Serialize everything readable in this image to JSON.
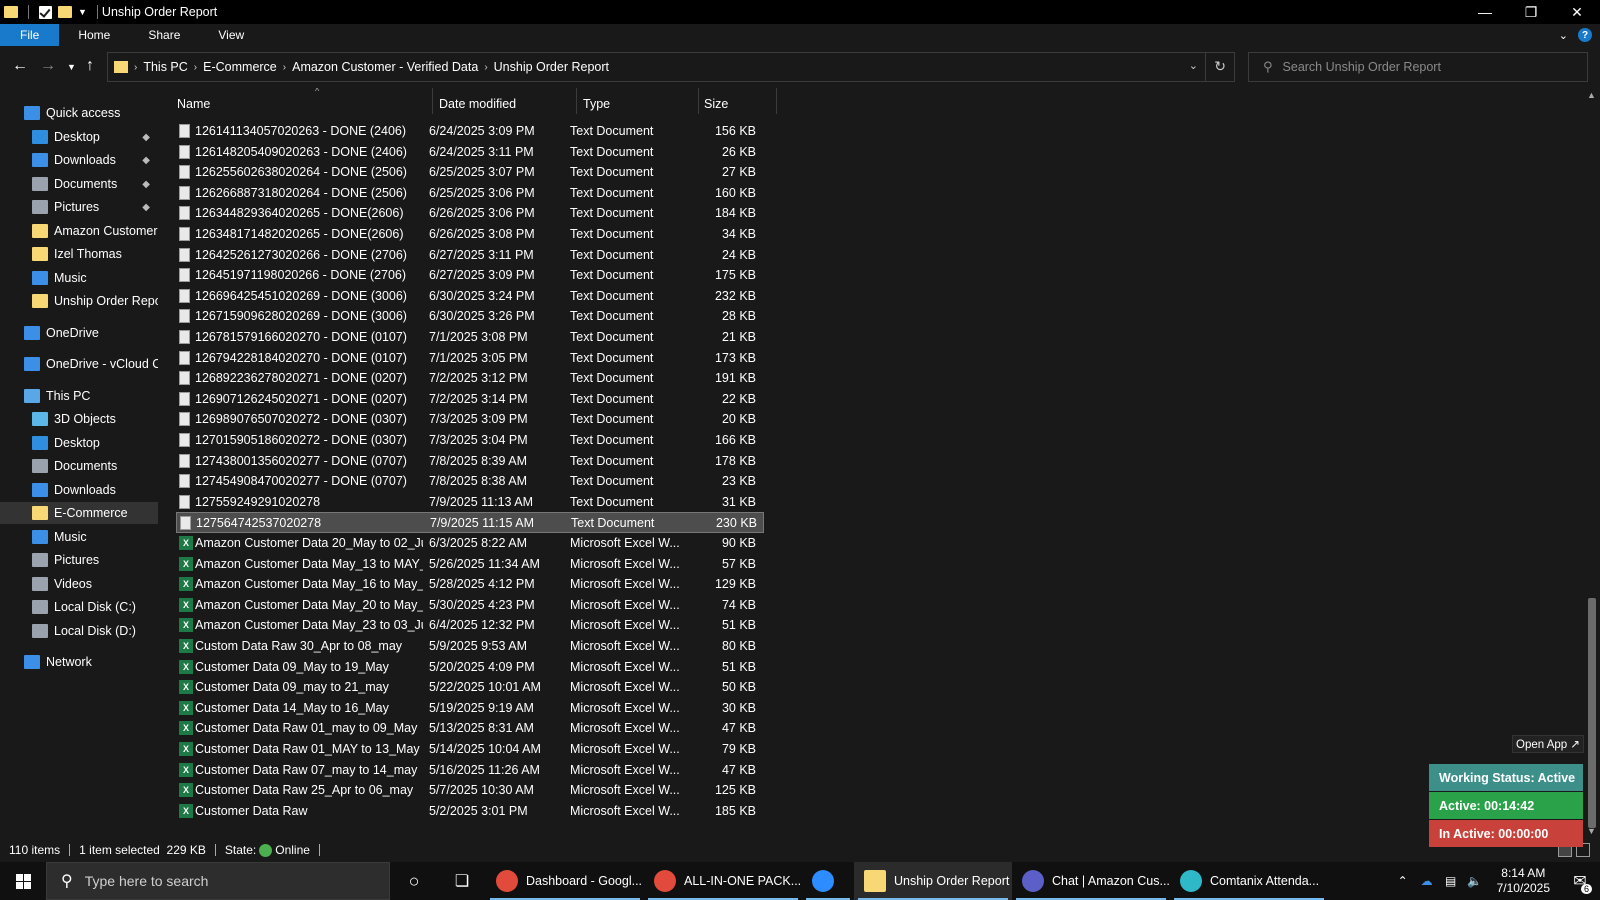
{
  "window": {
    "title": "Unship Order Report",
    "controls": [
      "minimize-icon",
      "restore-icon",
      "close-icon"
    ]
  },
  "ribbon": {
    "tabs": [
      "File",
      "Home",
      "Share",
      "View"
    ]
  },
  "address": {
    "crumbs": [
      "This PC",
      "E-Commerce",
      "Amazon Customer - Verified Data",
      "Unship Order Report"
    ]
  },
  "search": {
    "placeholder": "Search Unship Order Report"
  },
  "nav": {
    "items": [
      {
        "label": "Quick access",
        "icon": "star-icon",
        "color": "#3b8fe6",
        "pinned": false
      },
      {
        "label": "Desktop",
        "icon": "desktop-icon",
        "color": "#2f8ee0",
        "pinned": true
      },
      {
        "label": "Downloads",
        "icon": "download-icon",
        "color": "#3b8fe6",
        "pinned": true
      },
      {
        "label": "Documents",
        "icon": "documents-icon",
        "color": "#9aa3ad",
        "pinned": true
      },
      {
        "label": "Pictures",
        "icon": "pictures-icon",
        "color": "#9aa3ad",
        "pinned": true
      },
      {
        "label": "Amazon Customer",
        "icon": "folder-icon",
        "color": "#f8d775",
        "pinned": false
      },
      {
        "label": "Izel Thomas",
        "icon": "folder-icon",
        "color": "#f8d775",
        "pinned": false
      },
      {
        "label": "Music",
        "icon": "music-icon",
        "color": "#3b8fe6",
        "pinned": false
      },
      {
        "label": "Unship Order Repor",
        "icon": "folder-icon",
        "color": "#f8d775",
        "pinned": false
      },
      {
        "label": "OneDrive",
        "icon": "cloud-icon",
        "color": "#3b8fe6",
        "pinned": false
      },
      {
        "label": "OneDrive - vCloud Cl",
        "icon": "cloud-icon",
        "color": "#3b8fe6",
        "pinned": false
      },
      {
        "label": "This PC",
        "icon": "pc-icon",
        "color": "#5aa7e8",
        "pinned": false
      },
      {
        "label": "3D Objects",
        "icon": "3d-objects-icon",
        "color": "#5ab7e8",
        "pinned": false
      },
      {
        "label": "Desktop",
        "icon": "desktop-icon",
        "color": "#2f8ee0",
        "pinned": false
      },
      {
        "label": "Documents",
        "icon": "documents-icon",
        "color": "#9aa3ad",
        "pinned": false
      },
      {
        "label": "Downloads",
        "icon": "download-icon",
        "color": "#3b8fe6",
        "pinned": false
      },
      {
        "label": "E-Commerce",
        "icon": "folder-icon",
        "color": "#f8d775",
        "pinned": false
      },
      {
        "label": "Music",
        "icon": "music-icon",
        "color": "#3b8fe6",
        "pinned": false
      },
      {
        "label": "Pictures",
        "icon": "pictures-icon",
        "color": "#9aa3ad",
        "pinned": false
      },
      {
        "label": "Videos",
        "icon": "videos-icon",
        "color": "#9aa3ad",
        "pinned": false
      },
      {
        "label": "Local Disk (C:)",
        "icon": "drive-icon",
        "color": "#9aa3ad",
        "pinned": false
      },
      {
        "label": "Local Disk (D:)",
        "icon": "drive-icon",
        "color": "#9aa3ad",
        "pinned": false
      },
      {
        "label": "Network",
        "icon": "network-icon",
        "color": "#3b8fe6",
        "pinned": false
      }
    ]
  },
  "columns": [
    "Name",
    "Date modified",
    "Type",
    "Size"
  ],
  "files": [
    {
      "name": "126141134057020263 - DONE (2406)",
      "date": "6/24/2025 3:09 PM",
      "type": "Text Document",
      "size": "156 KB",
      "kind": "txt"
    },
    {
      "name": "126148205409020263 - DONE (2406)",
      "date": "6/24/2025 3:11 PM",
      "type": "Text Document",
      "size": "26 KB",
      "kind": "txt"
    },
    {
      "name": "126255602638020264 - DONE (2506)",
      "date": "6/25/2025 3:07 PM",
      "type": "Text Document",
      "size": "27 KB",
      "kind": "txt"
    },
    {
      "name": "126266887318020264 - DONE (2506)",
      "date": "6/25/2025 3:06 PM",
      "type": "Text Document",
      "size": "160 KB",
      "kind": "txt"
    },
    {
      "name": "126344829364020265 - DONE(2606)",
      "date": "6/26/2025 3:06 PM",
      "type": "Text Document",
      "size": "184 KB",
      "kind": "txt"
    },
    {
      "name": "126348171482020265 - DONE(2606)",
      "date": "6/26/2025 3:08 PM",
      "type": "Text Document",
      "size": "34 KB",
      "kind": "txt"
    },
    {
      "name": "126425261273020266 - DONE (2706)",
      "date": "6/27/2025 3:11 PM",
      "type": "Text Document",
      "size": "24 KB",
      "kind": "txt"
    },
    {
      "name": "126451971198020266 - DONE (2706)",
      "date": "6/27/2025 3:09 PM",
      "type": "Text Document",
      "size": "175 KB",
      "kind": "txt"
    },
    {
      "name": "126696425451020269 - DONE (3006)",
      "date": "6/30/2025 3:24 PM",
      "type": "Text Document",
      "size": "232 KB",
      "kind": "txt"
    },
    {
      "name": "126715909628020269 - DONE (3006)",
      "date": "6/30/2025 3:26 PM",
      "type": "Text Document",
      "size": "28 KB",
      "kind": "txt"
    },
    {
      "name": "126781579166020270 - DONE (0107)",
      "date": "7/1/2025 3:08 PM",
      "type": "Text Document",
      "size": "21 KB",
      "kind": "txt"
    },
    {
      "name": "126794228184020270 - DONE (0107)",
      "date": "7/1/2025 3:05 PM",
      "type": "Text Document",
      "size": "173 KB",
      "kind": "txt"
    },
    {
      "name": "126892236278020271 - DONE (0207)",
      "date": "7/2/2025 3:12 PM",
      "type": "Text Document",
      "size": "191 KB",
      "kind": "txt"
    },
    {
      "name": "126907126245020271 - DONE (0207)",
      "date": "7/2/2025 3:14 PM",
      "type": "Text Document",
      "size": "22 KB",
      "kind": "txt"
    },
    {
      "name": "126989076507020272 - DONE (0307)",
      "date": "7/3/2025 3:09 PM",
      "type": "Text Document",
      "size": "20 KB",
      "kind": "txt"
    },
    {
      "name": "127015905186020272 - DONE (0307)",
      "date": "7/3/2025 3:04 PM",
      "type": "Text Document",
      "size": "166 KB",
      "kind": "txt"
    },
    {
      "name": "127438001356020277 - DONE (0707)",
      "date": "7/8/2025 8:39 AM",
      "type": "Text Document",
      "size": "178 KB",
      "kind": "txt"
    },
    {
      "name": "127454908470020277 - DONE (0707)",
      "date": "7/8/2025 8:38 AM",
      "type": "Text Document",
      "size": "23 KB",
      "kind": "txt"
    },
    {
      "name": "127559249291020278",
      "date": "7/9/2025 11:13 AM",
      "type": "Text Document",
      "size": "31 KB",
      "kind": "txt"
    },
    {
      "name": "127564742537020278",
      "date": "7/9/2025 11:15 AM",
      "type": "Text Document",
      "size": "230 KB",
      "kind": "txt",
      "selected": true
    },
    {
      "name": "Amazon Customer Data 20_May to 02_Ju...",
      "date": "6/3/2025 8:22 AM",
      "type": "Microsoft Excel W...",
      "size": "90 KB",
      "kind": "xls"
    },
    {
      "name": "Amazon Customer Data May_13 to MAY_...",
      "date": "5/26/2025 11:34 AM",
      "type": "Microsoft Excel W...",
      "size": "57 KB",
      "kind": "xls"
    },
    {
      "name": "Amazon Customer Data May_16 to May_28",
      "date": "5/28/2025 4:12 PM",
      "type": "Microsoft Excel W...",
      "size": "129 KB",
      "kind": "xls"
    },
    {
      "name": "Amazon Customer Data May_20 to May_29",
      "date": "5/30/2025 4:23 PM",
      "type": "Microsoft Excel W...",
      "size": "74 KB",
      "kind": "xls"
    },
    {
      "name": "Amazon Customer Data May_23 to 03_Ju...",
      "date": "6/4/2025 12:32 PM",
      "type": "Microsoft Excel W...",
      "size": "51 KB",
      "kind": "xls"
    },
    {
      "name": "Custom Data Raw 30_Apr to 08_may",
      "date": "5/9/2025 9:53 AM",
      "type": "Microsoft Excel W...",
      "size": "80 KB",
      "kind": "xls"
    },
    {
      "name": "Customer Data 09_May to 19_May",
      "date": "5/20/2025 4:09 PM",
      "type": "Microsoft Excel W...",
      "size": "51 KB",
      "kind": "xls"
    },
    {
      "name": "Customer Data 09_may to 21_may",
      "date": "5/22/2025 10:01 AM",
      "type": "Microsoft Excel W...",
      "size": "50 KB",
      "kind": "xls"
    },
    {
      "name": "Customer Data 14_May to 16_May",
      "date": "5/19/2025 9:19 AM",
      "type": "Microsoft Excel W...",
      "size": "30 KB",
      "kind": "xls"
    },
    {
      "name": "Customer Data Raw 01_may to 09_May",
      "date": "5/13/2025 8:31 AM",
      "type": "Microsoft Excel W...",
      "size": "47 KB",
      "kind": "xls"
    },
    {
      "name": "Customer Data Raw 01_MAY to 13_May",
      "date": "5/14/2025 10:04 AM",
      "type": "Microsoft Excel W...",
      "size": "79 KB",
      "kind": "xls"
    },
    {
      "name": "Customer Data Raw 07_may to 14_may",
      "date": "5/16/2025 11:26 AM",
      "type": "Microsoft Excel W...",
      "size": "47 KB",
      "kind": "xls"
    },
    {
      "name": "Customer Data Raw 25_Apr to 06_may",
      "date": "5/7/2025 10:30 AM",
      "type": "Microsoft Excel W...",
      "size": "125 KB",
      "kind": "xls"
    },
    {
      "name": "Customer Data Raw",
      "date": "5/2/2025 3:01 PM",
      "type": "Microsoft Excel W...",
      "size": "185 KB",
      "kind": "xls"
    }
  ],
  "status": {
    "count": "110 items",
    "selected": "1 item selected  229 KB",
    "state_label": "State:",
    "state_value": "Online"
  },
  "widget": {
    "open_app": "Open App ↗",
    "working": "Working Status: Active",
    "active": "Active: 00:14:42",
    "inactive": "In Active: 00:00:00",
    "colors": {
      "working": "#3d8f8a",
      "active": "#2aa24a",
      "inactive": "#c8423b"
    }
  },
  "taskbar": {
    "search_placeholder": "Type here to search",
    "tasks": [
      {
        "label": "Dashboard - Googl...",
        "icon": "chrome-icon",
        "color": "#e24b3b",
        "active": false
      },
      {
        "label": "ALL-IN-ONE PACK...",
        "icon": "chrome-icon",
        "color": "#e24b3b",
        "active": false
      },
      {
        "label": "",
        "icon": "zoom-icon",
        "color": "#2d8cff",
        "active": false
      },
      {
        "label": "Unship Order Report",
        "icon": "file-explorer-icon",
        "color": "#f8d775",
        "active": true
      },
      {
        "label": "Chat | Amazon Cus...",
        "icon": "teams-icon",
        "color": "#5b5fc7",
        "active": false
      },
      {
        "label": "Comtanix Attenda...",
        "icon": "comtanix-icon",
        "color": "#2fb8c8",
        "active": false
      }
    ],
    "time": "8:14 AM",
    "date": "7/10/2025",
    "notifications": "6"
  }
}
